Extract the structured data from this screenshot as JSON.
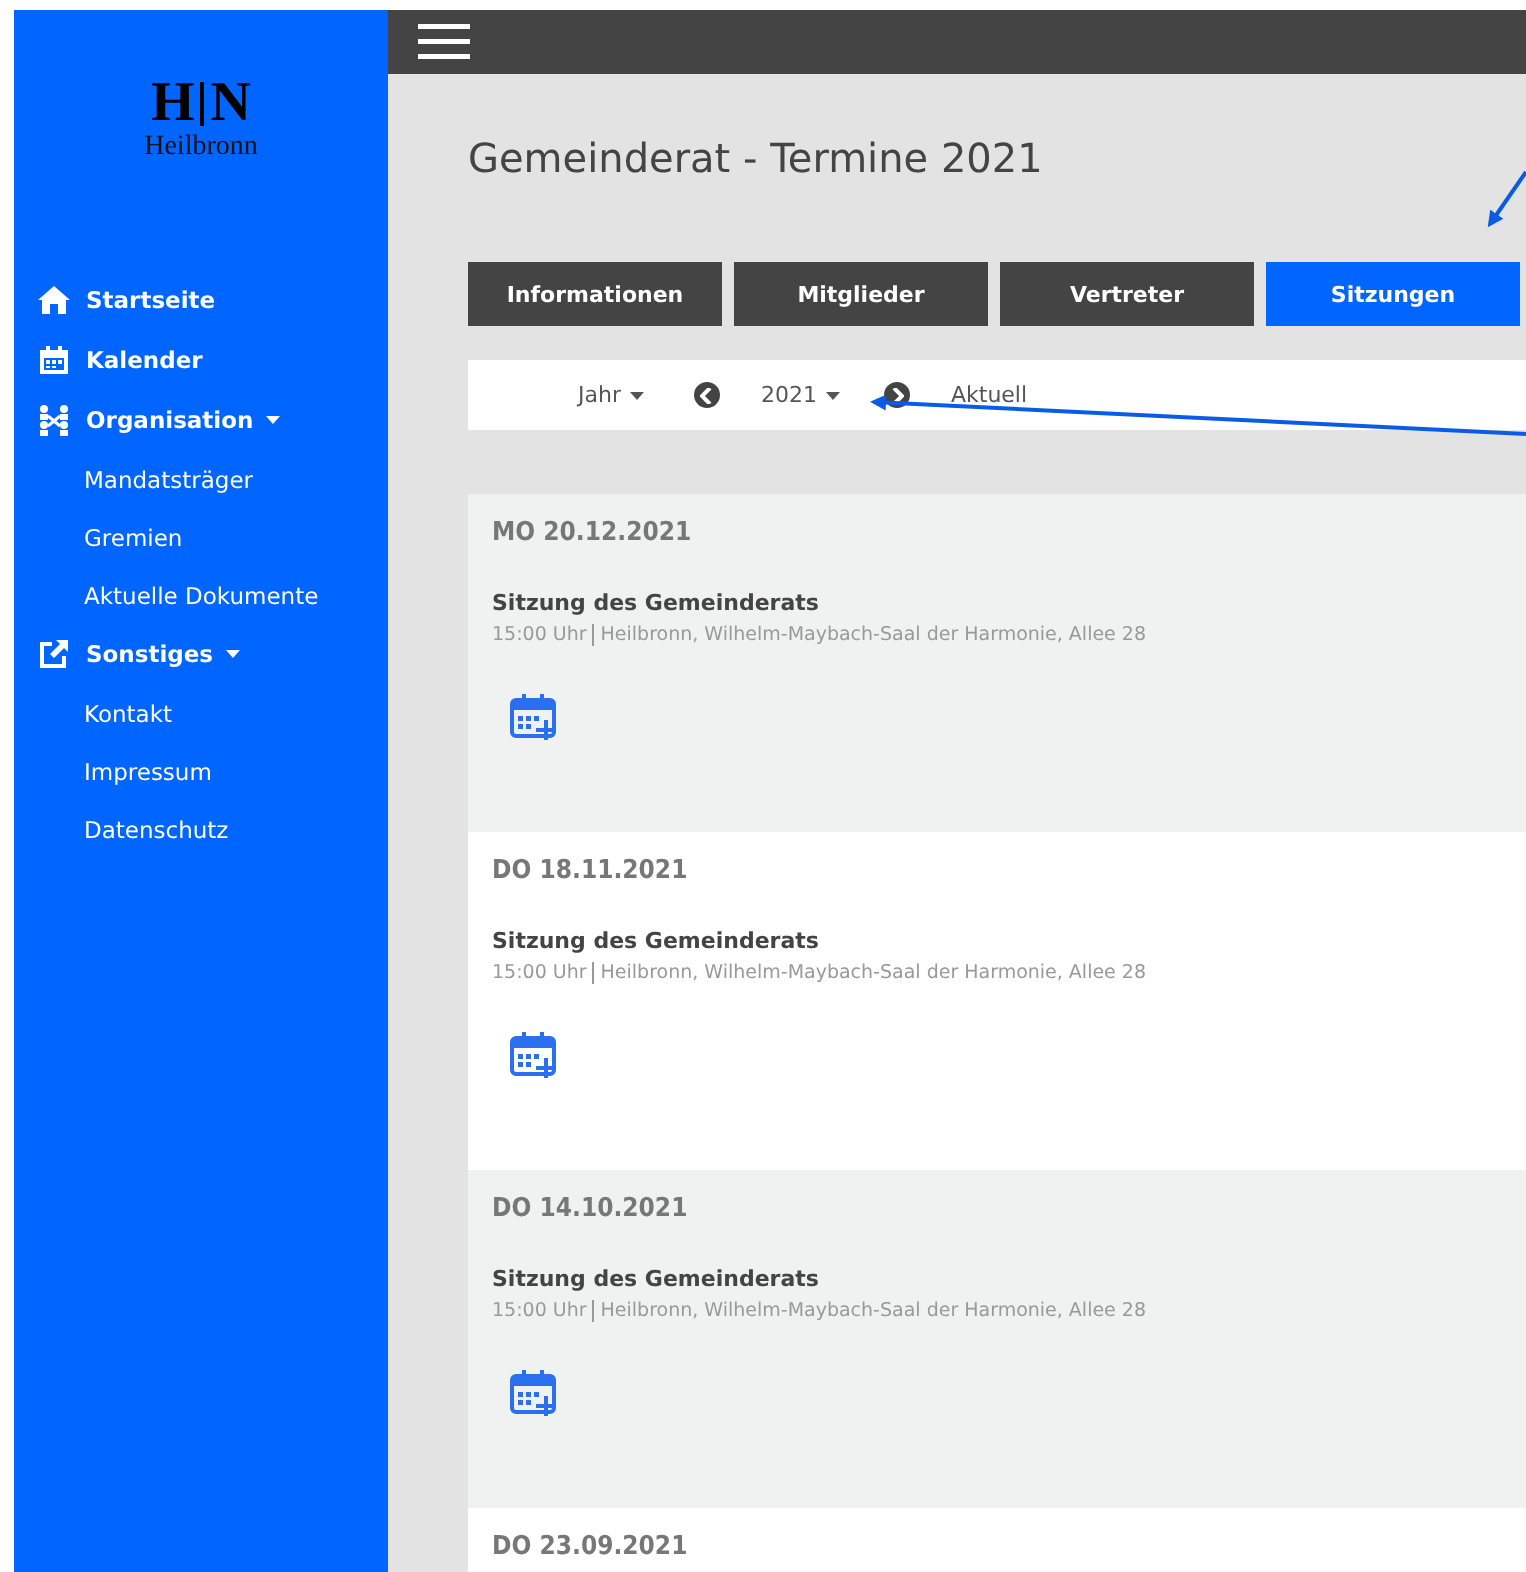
{
  "sidebar": {
    "logo": {
      "mark": "H",
      "mark_right": "N",
      "city": "Heilbronn"
    },
    "items": [
      {
        "label": "Startseite",
        "dropdown": false
      },
      {
        "label": "Kalender",
        "dropdown": false
      },
      {
        "label": "Organisation",
        "dropdown": true,
        "children": [
          {
            "label": "Mandatsträger"
          },
          {
            "label": "Gremien"
          },
          {
            "label": "Aktuelle Dokumente"
          }
        ]
      },
      {
        "label": "Sonstiges",
        "dropdown": true,
        "children": [
          {
            "label": "Kontakt"
          },
          {
            "label": "Impressum"
          },
          {
            "label": "Datenschutz"
          }
        ]
      }
    ]
  },
  "page_title": "Gemeinderat - Termine 2021",
  "tabs": [
    {
      "label": "Informationen",
      "selected": false
    },
    {
      "label": "Mitglieder",
      "selected": false
    },
    {
      "label": "Vertreter",
      "selected": false
    },
    {
      "label": "Sitzungen",
      "selected": true
    }
  ],
  "filter": {
    "period": "Jahr",
    "year": "2021",
    "current": "Aktuell"
  },
  "events": [
    {
      "date": "MO 20.12.2021",
      "title": "Sitzung des Gemeinderats",
      "time": "15:00 Uhr",
      "place": "Heilbronn, Wilhelm-Maybach-Saal der Harmonie, Allee 28"
    },
    {
      "date": "DO 18.11.2021",
      "title": "Sitzung des Gemeinderats",
      "time": "15:00 Uhr",
      "place": "Heilbronn, Wilhelm-Maybach-Saal der Harmonie, Allee 28"
    },
    {
      "date": "DO 14.10.2021",
      "title": "Sitzung des Gemeinderats",
      "time": "15:00 Uhr",
      "place": "Heilbronn, Wilhelm-Maybach-Saal der Harmonie, Allee 28"
    },
    {
      "date": "DO 23.09.2021"
    }
  ]
}
